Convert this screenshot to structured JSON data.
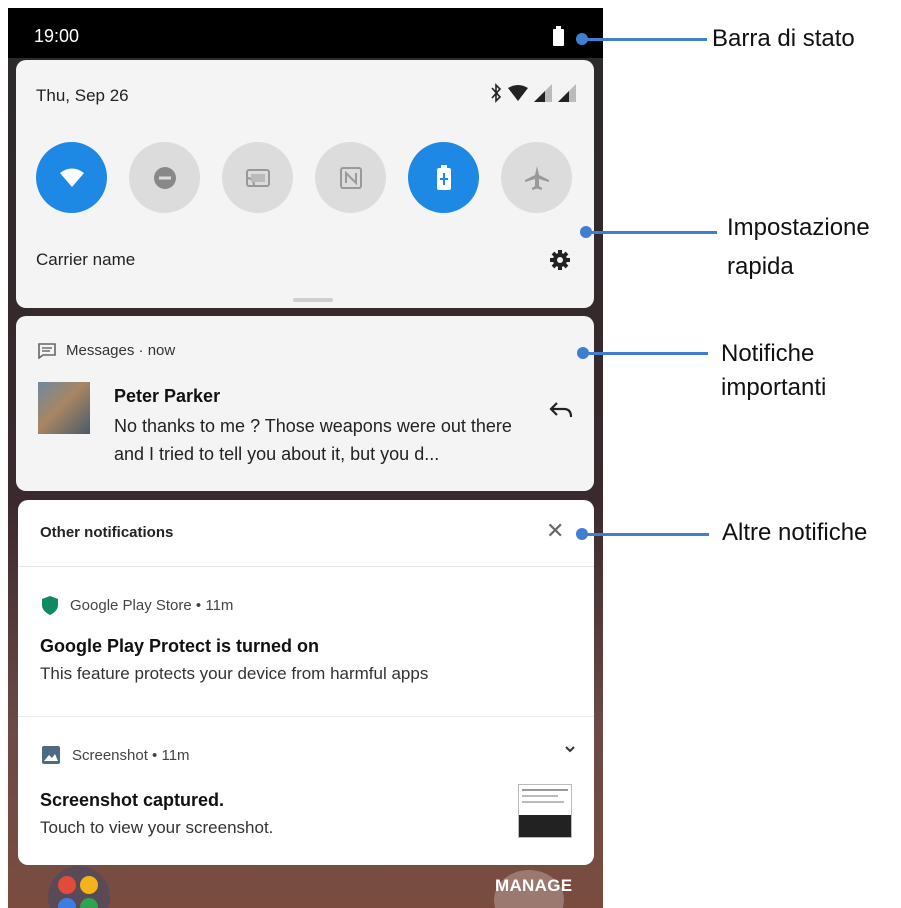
{
  "status_bar": {
    "time": "19:00"
  },
  "quick_settings": {
    "date": "Thu, Sep 26",
    "carrier": "Carrier name",
    "tiles": [
      {
        "icon": "wifi-icon",
        "state": "on"
      },
      {
        "icon": "do-not-disturb-icon",
        "state": "off"
      },
      {
        "icon": "cast-icon",
        "state": "off"
      },
      {
        "icon": "nfc-icon",
        "state": "off"
      },
      {
        "icon": "battery-saver-icon",
        "state": "on"
      },
      {
        "icon": "airplane-mode-icon",
        "state": "off"
      }
    ]
  },
  "important_notification": {
    "app": "Messages",
    "time": "now",
    "sender": "Peter Parker",
    "text": "No thanks to me ? Those weapons were out there and I tried  to  tell you about it, but you d..."
  },
  "other_notifications": {
    "title": "Other notifications",
    "items": [
      {
        "app": "Google Play Store",
        "time": "11m",
        "title": "Google Play Protect is turned on",
        "body": "This feature protects your device from harmful apps",
        "icon": "shield-icon"
      },
      {
        "app": "Screenshot",
        "time": "11m",
        "title": "Screenshot captured.",
        "body": "Touch to view your screenshot.",
        "icon": "image-icon"
      }
    ]
  },
  "dock": {
    "manage_label": "MANAGE"
  },
  "annotations": {
    "status_bar": "Barra di stato",
    "quick_settings_line1": "Impostazione",
    "quick_settings_line2": "rapida",
    "important_line1": "Notifiche",
    "important_line2": "importanti",
    "other": "Altre notifiche"
  },
  "colors": {
    "accent": "#1e88e5",
    "callout": "#3f7fd0",
    "shield": "#0f8a5f"
  }
}
